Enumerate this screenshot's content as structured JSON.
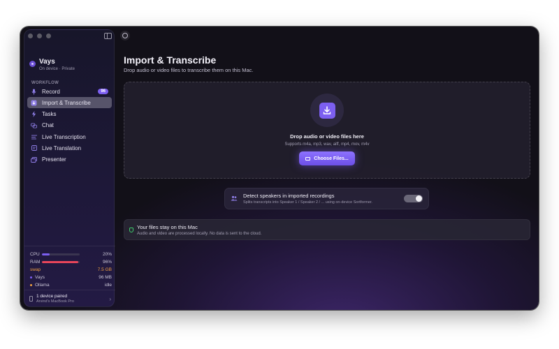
{
  "app": {
    "name": "Vays",
    "subtitle": "On device · Private"
  },
  "sidebar": {
    "section_label": "WORKFLOW",
    "items": [
      {
        "label": "Record",
        "icon": "mic-icon",
        "badge": "96"
      },
      {
        "label": "Import & Transcribe",
        "icon": "import-icon",
        "active": true
      },
      {
        "label": "Tasks",
        "icon": "bolt-icon"
      },
      {
        "label": "Chat",
        "icon": "chat-icon"
      },
      {
        "label": "Live Transcription",
        "icon": "lines-icon"
      },
      {
        "label": "Live Translation",
        "icon": "translate-icon"
      },
      {
        "label": "Presenter",
        "icon": "presenter-icon"
      }
    ]
  },
  "stats": {
    "cpu": {
      "label": "CPU",
      "value": "20%",
      "fraction": 0.2,
      "color": "#7c5ff0"
    },
    "ram": {
      "label": "RAM",
      "value": "96%",
      "fraction": 0.96,
      "color": "#e8455a"
    },
    "swap": {
      "label": "swap",
      "value": "7.5 GB",
      "color": "#f0a040"
    },
    "processes": [
      {
        "name": "Vays",
        "value": "96 MB",
        "color": "#7c5ff0"
      },
      {
        "name": "Ollama",
        "value": "idle",
        "color": "#f0a040"
      }
    ]
  },
  "device": {
    "title": "1 device paired",
    "subtitle": "Arvind's MacBook Pro"
  },
  "main": {
    "title": "Import & Transcribe",
    "subtitle": "Drop audio or video files to transcribe them on this Mac.",
    "dropzone": {
      "title": "Drop audio or video files here",
      "formats": "Supports m4a, mp3, wav, aiff, mp4, mov, m4v",
      "button_label": "Choose Files..."
    },
    "speakers": {
      "title": "Detect speakers in imported recordings",
      "subtitle": "Splits transcripts into Speaker 1 / Speaker 2 / ... using on-device Sortformer.",
      "enabled": true
    },
    "privacy": {
      "title": "Your files stay on this Mac",
      "subtitle": "Audio and video are processed locally. No data is sent to the cloud."
    }
  }
}
